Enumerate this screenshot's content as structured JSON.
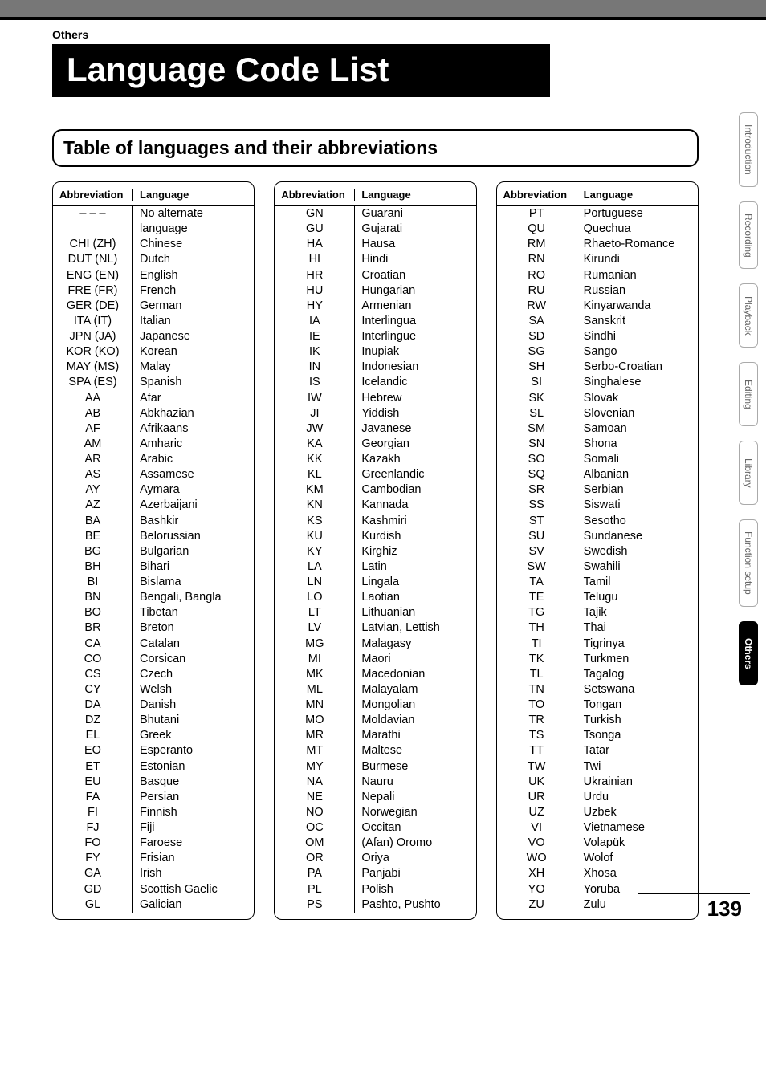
{
  "section_label": "Others",
  "title": "Language Code List",
  "subtitle": "Table of languages and their abbreviations",
  "headers": {
    "abbr": "Abbreviation",
    "lang": "Language"
  },
  "sidetabs": [
    {
      "label": "Introduction",
      "active": false
    },
    {
      "label": "Recording",
      "active": false
    },
    {
      "label": "Playback",
      "active": false
    },
    {
      "label": "Editing",
      "active": false
    },
    {
      "label": "Library",
      "active": false
    },
    {
      "label": "Function setup",
      "active": false
    },
    {
      "label": "Others",
      "active": true
    }
  ],
  "page_number": "139",
  "columns": [
    [
      {
        "abbr": "– – –",
        "lang": "No alternate language"
      },
      {
        "abbr": "CHI (ZH)",
        "lang": "Chinese"
      },
      {
        "abbr": "DUT (NL)",
        "lang": "Dutch"
      },
      {
        "abbr": "ENG (EN)",
        "lang": "English"
      },
      {
        "abbr": "FRE (FR)",
        "lang": "French"
      },
      {
        "abbr": "GER (DE)",
        "lang": "German"
      },
      {
        "abbr": "ITA (IT)",
        "lang": "Italian"
      },
      {
        "abbr": "JPN (JA)",
        "lang": "Japanese"
      },
      {
        "abbr": "KOR (KO)",
        "lang": "Korean"
      },
      {
        "abbr": "MAY (MS)",
        "lang": "Malay"
      },
      {
        "abbr": "SPA (ES)",
        "lang": "Spanish"
      },
      {
        "abbr": "AA",
        "lang": "Afar"
      },
      {
        "abbr": "AB",
        "lang": "Abkhazian"
      },
      {
        "abbr": "AF",
        "lang": "Afrikaans"
      },
      {
        "abbr": "AM",
        "lang": "Amharic"
      },
      {
        "abbr": "AR",
        "lang": "Arabic"
      },
      {
        "abbr": "AS",
        "lang": "Assamese"
      },
      {
        "abbr": "AY",
        "lang": "Aymara"
      },
      {
        "abbr": "AZ",
        "lang": "Azerbaijani"
      },
      {
        "abbr": "BA",
        "lang": "Bashkir"
      },
      {
        "abbr": "BE",
        "lang": "Belorussian"
      },
      {
        "abbr": "BG",
        "lang": "Bulgarian"
      },
      {
        "abbr": "BH",
        "lang": "Bihari"
      },
      {
        "abbr": "BI",
        "lang": "Bislama"
      },
      {
        "abbr": "BN",
        "lang": "Bengali, Bangla"
      },
      {
        "abbr": "BO",
        "lang": "Tibetan"
      },
      {
        "abbr": "BR",
        "lang": "Breton"
      },
      {
        "abbr": "CA",
        "lang": "Catalan"
      },
      {
        "abbr": "CO",
        "lang": "Corsican"
      },
      {
        "abbr": "CS",
        "lang": "Czech"
      },
      {
        "abbr": "CY",
        "lang": "Welsh"
      },
      {
        "abbr": "DA",
        "lang": "Danish"
      },
      {
        "abbr": "DZ",
        "lang": "Bhutani"
      },
      {
        "abbr": "EL",
        "lang": "Greek"
      },
      {
        "abbr": "EO",
        "lang": "Esperanto"
      },
      {
        "abbr": "ET",
        "lang": "Estonian"
      },
      {
        "abbr": "EU",
        "lang": "Basque"
      },
      {
        "abbr": "FA",
        "lang": "Persian"
      },
      {
        "abbr": "FI",
        "lang": "Finnish"
      },
      {
        "abbr": "FJ",
        "lang": "Fiji"
      },
      {
        "abbr": "FO",
        "lang": "Faroese"
      },
      {
        "abbr": "FY",
        "lang": "Frisian"
      },
      {
        "abbr": "GA",
        "lang": "Irish"
      },
      {
        "abbr": "GD",
        "lang": "Scottish Gaelic"
      },
      {
        "abbr": "GL",
        "lang": "Galician"
      }
    ],
    [
      {
        "abbr": "GN",
        "lang": "Guarani"
      },
      {
        "abbr": "GU",
        "lang": "Gujarati"
      },
      {
        "abbr": "HA",
        "lang": "Hausa"
      },
      {
        "abbr": "HI",
        "lang": "Hindi"
      },
      {
        "abbr": "HR",
        "lang": "Croatian"
      },
      {
        "abbr": "HU",
        "lang": "Hungarian"
      },
      {
        "abbr": "HY",
        "lang": "Armenian"
      },
      {
        "abbr": "IA",
        "lang": "Interlingua"
      },
      {
        "abbr": "IE",
        "lang": "Interlingue"
      },
      {
        "abbr": "IK",
        "lang": "Inupiak"
      },
      {
        "abbr": "IN",
        "lang": "Indonesian"
      },
      {
        "abbr": "IS",
        "lang": "Icelandic"
      },
      {
        "abbr": "IW",
        "lang": "Hebrew"
      },
      {
        "abbr": "JI",
        "lang": "Yiddish"
      },
      {
        "abbr": "JW",
        "lang": "Javanese"
      },
      {
        "abbr": "KA",
        "lang": "Georgian"
      },
      {
        "abbr": "KK",
        "lang": "Kazakh"
      },
      {
        "abbr": "KL",
        "lang": "Greenlandic"
      },
      {
        "abbr": "KM",
        "lang": "Cambodian"
      },
      {
        "abbr": "KN",
        "lang": "Kannada"
      },
      {
        "abbr": "KS",
        "lang": "Kashmiri"
      },
      {
        "abbr": "KU",
        "lang": "Kurdish"
      },
      {
        "abbr": "KY",
        "lang": "Kirghiz"
      },
      {
        "abbr": "LA",
        "lang": "Latin"
      },
      {
        "abbr": "LN",
        "lang": "Lingala"
      },
      {
        "abbr": "LO",
        "lang": "Laotian"
      },
      {
        "abbr": "LT",
        "lang": "Lithuanian"
      },
      {
        "abbr": "LV",
        "lang": "Latvian, Lettish"
      },
      {
        "abbr": "MG",
        "lang": "Malagasy"
      },
      {
        "abbr": "MI",
        "lang": "Maori"
      },
      {
        "abbr": "MK",
        "lang": "Macedonian"
      },
      {
        "abbr": "ML",
        "lang": "Malayalam"
      },
      {
        "abbr": "MN",
        "lang": "Mongolian"
      },
      {
        "abbr": "MO",
        "lang": "Moldavian"
      },
      {
        "abbr": "MR",
        "lang": "Marathi"
      },
      {
        "abbr": "MT",
        "lang": "Maltese"
      },
      {
        "abbr": "MY",
        "lang": "Burmese"
      },
      {
        "abbr": "NA",
        "lang": "Nauru"
      },
      {
        "abbr": "NE",
        "lang": "Nepali"
      },
      {
        "abbr": "NO",
        "lang": "Norwegian"
      },
      {
        "abbr": "OC",
        "lang": "Occitan"
      },
      {
        "abbr": "OM",
        "lang": "(Afan) Oromo"
      },
      {
        "abbr": "OR",
        "lang": "Oriya"
      },
      {
        "abbr": "PA",
        "lang": "Panjabi"
      },
      {
        "abbr": "PL",
        "lang": "Polish"
      },
      {
        "abbr": "PS",
        "lang": "Pashto, Pushto"
      }
    ],
    [
      {
        "abbr": "PT",
        "lang": "Portuguese"
      },
      {
        "abbr": "QU",
        "lang": "Quechua"
      },
      {
        "abbr": "RM",
        "lang": "Rhaeto-Romance"
      },
      {
        "abbr": "RN",
        "lang": "Kirundi"
      },
      {
        "abbr": "RO",
        "lang": "Rumanian"
      },
      {
        "abbr": "RU",
        "lang": "Russian"
      },
      {
        "abbr": "RW",
        "lang": "Kinyarwanda"
      },
      {
        "abbr": "SA",
        "lang": "Sanskrit"
      },
      {
        "abbr": "SD",
        "lang": "Sindhi"
      },
      {
        "abbr": "SG",
        "lang": "Sango"
      },
      {
        "abbr": "SH",
        "lang": "Serbo-Croatian"
      },
      {
        "abbr": "SI",
        "lang": "Singhalese"
      },
      {
        "abbr": "SK",
        "lang": "Slovak"
      },
      {
        "abbr": "SL",
        "lang": "Slovenian"
      },
      {
        "abbr": "SM",
        "lang": "Samoan"
      },
      {
        "abbr": "SN",
        "lang": "Shona"
      },
      {
        "abbr": "SO",
        "lang": "Somali"
      },
      {
        "abbr": "SQ",
        "lang": "Albanian"
      },
      {
        "abbr": "SR",
        "lang": "Serbian"
      },
      {
        "abbr": "SS",
        "lang": "Siswati"
      },
      {
        "abbr": "ST",
        "lang": "Sesotho"
      },
      {
        "abbr": "SU",
        "lang": "Sundanese"
      },
      {
        "abbr": "SV",
        "lang": "Swedish"
      },
      {
        "abbr": "SW",
        "lang": "Swahili"
      },
      {
        "abbr": "TA",
        "lang": "Tamil"
      },
      {
        "abbr": "TE",
        "lang": "Telugu"
      },
      {
        "abbr": "TG",
        "lang": "Tajik"
      },
      {
        "abbr": "TH",
        "lang": "Thai"
      },
      {
        "abbr": "TI",
        "lang": "Tigrinya"
      },
      {
        "abbr": "TK",
        "lang": "Turkmen"
      },
      {
        "abbr": "TL",
        "lang": "Tagalog"
      },
      {
        "abbr": "TN",
        "lang": "Setswana"
      },
      {
        "abbr": "TO",
        "lang": "Tongan"
      },
      {
        "abbr": "TR",
        "lang": "Turkish"
      },
      {
        "abbr": "TS",
        "lang": "Tsonga"
      },
      {
        "abbr": "TT",
        "lang": "Tatar"
      },
      {
        "abbr": "TW",
        "lang": "Twi"
      },
      {
        "abbr": "UK",
        "lang": "Ukrainian"
      },
      {
        "abbr": "UR",
        "lang": "Urdu"
      },
      {
        "abbr": "UZ",
        "lang": "Uzbek"
      },
      {
        "abbr": "VI",
        "lang": "Vietnamese"
      },
      {
        "abbr": "VO",
        "lang": "Volapük"
      },
      {
        "abbr": "WO",
        "lang": "Wolof"
      },
      {
        "abbr": "XH",
        "lang": "Xhosa"
      },
      {
        "abbr": "YO",
        "lang": "Yoruba"
      },
      {
        "abbr": "ZU",
        "lang": "Zulu"
      }
    ]
  ]
}
